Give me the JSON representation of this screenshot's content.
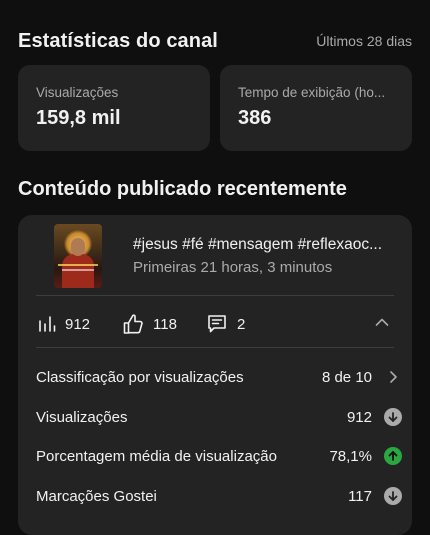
{
  "header": {
    "title": "Estatísticas do canal",
    "period": "Últimos 28 dias"
  },
  "stats": [
    {
      "label": "Visualizações",
      "value": "159,8 mil"
    },
    {
      "label": "Tempo de exibição (ho...",
      "value": "386"
    }
  ],
  "recent": {
    "title": "Conteúdo publicado recentemente",
    "video": {
      "title": "#jesus #fé #mensagem #reflexaoc...",
      "subtitle": "Primeiras 21 horas, 3 minutos",
      "views": "912",
      "likes": "118",
      "comments": "2"
    },
    "rows": [
      {
        "label": "Classificação por visualizações",
        "value": "8 de 10",
        "icon": "chevron-right-icon"
      },
      {
        "label": "Visualizações",
        "value": "912",
        "icon": "arrow-down-circle-icon",
        "icon_color": "#aaaaaa"
      },
      {
        "label": "Porcentagem média de visualização",
        "value": "78,1%",
        "icon": "arrow-up-circle-icon",
        "icon_color": "#2ba640"
      },
      {
        "label": "Marcações Gostei",
        "value": "117",
        "icon": "arrow-down-circle-icon",
        "icon_color": "#aaaaaa"
      }
    ]
  }
}
